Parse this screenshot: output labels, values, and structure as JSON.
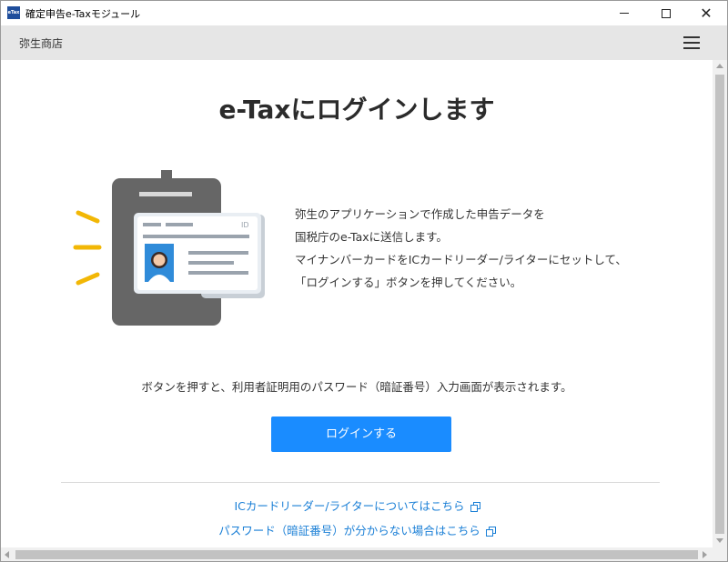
{
  "window": {
    "title": "確定申告e-Taxモジュール",
    "icon_text": "eTax"
  },
  "header": {
    "company": "弥生商店",
    "menu_icon": "hamburger-menu-icon"
  },
  "main": {
    "heading": "e-Taxにログインします",
    "card_label": "ID",
    "description": [
      "弥生のアプリケーションで作成した申告データを",
      "国税庁のe-Taxに送信します。",
      "マイナンバーカードをICカードリーダー/ライターにセットして、",
      "「ログインする」ボタンを押してください。"
    ],
    "note": "ボタンを押すと、利用者証明用のパスワード（暗証番号）入力画面が表示されます。",
    "login_button": "ログインする",
    "links": [
      "ICカードリーダー/ライターについてはこちら",
      "パスワード（暗証番号）が分からない場合はこちら"
    ]
  },
  "colors": {
    "accent": "#1a8cff",
    "link": "#1a7fd6",
    "header_bg": "#e6e6e6",
    "reader_body": "#666666",
    "signal": "#f2b705"
  }
}
